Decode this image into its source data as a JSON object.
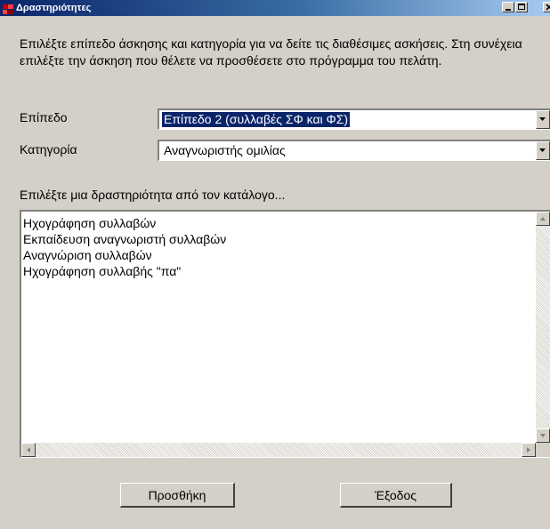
{
  "window": {
    "title": "Δραστηριότητες",
    "app_icon": "app-icon",
    "minimize_icon": "minimize-icon",
    "maximize_icon": "maximize-icon",
    "close_icon": "close-icon"
  },
  "instructions": "Επιλέξτε επίπεδο άσκησης και κατηγορία για να δείτε τις διαθέσιμες ασκήσεις. Στη συνέχεια επιλέξτε την άσκηση που θέλετε να προσθέσετε στο πρόγραμμα του πελάτη.",
  "level": {
    "label": "Επίπεδο",
    "value": "Επίπεδο 2 (συλλαβές ΣΦ και ΦΣ)"
  },
  "category": {
    "label": "Κατηγορία",
    "value": "Αναγνωριστής ομιλίας"
  },
  "activities": {
    "prompt": "Επιλέξτε μια δραστηριότητα από τον κατάλογο...",
    "items": [
      "Ηχογράφηση συλλαβών",
      "Εκπαίδευση αναγνωριστή συλλαβών",
      "Αναγνώριση συλλαβών",
      "Ηχογράφηση συλλαβής \"πα\""
    ]
  },
  "buttons": {
    "add": "Προσθήκη",
    "exit": "Έξοδος"
  },
  "colors": {
    "title_bar": "#0a246a",
    "face": "#d4d0c8",
    "selection": "#0a246a"
  }
}
